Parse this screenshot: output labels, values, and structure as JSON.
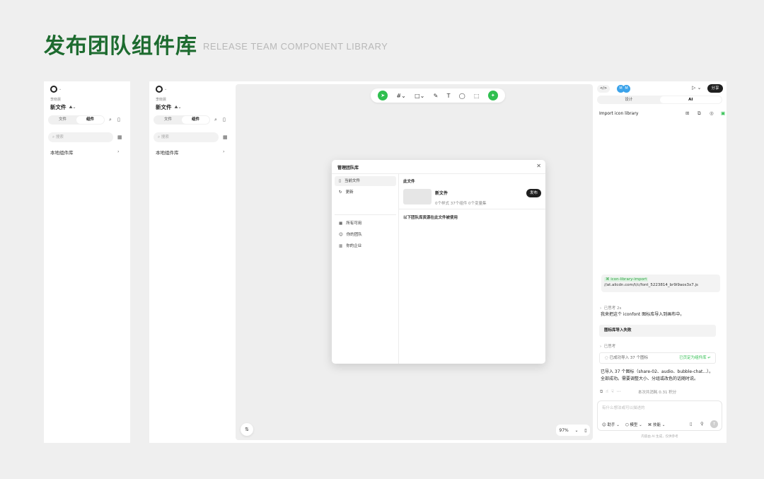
{
  "header": {
    "title": "发布团队组件库",
    "subtitle": "RELEASE TEAM COMPONENT LIBRARY"
  },
  "left_panel": {
    "team": "李晓晨",
    "file_name": "新文件",
    "tabs": [
      "文件",
      "组件"
    ],
    "search_placeholder": "搜索",
    "local_library": "本地组件库"
  },
  "toolbar": {
    "icons": [
      "move-tool",
      "frame-tool",
      "shape-tool",
      "pen-tool",
      "text-tool",
      "comment-tool",
      "crop-tool",
      "ai-tool"
    ]
  },
  "canvas": {
    "zoom": "97%"
  },
  "modal": {
    "title": "管理团队库",
    "sidebar": [
      {
        "label": "当前文件",
        "icon": "book-icon",
        "selected": true
      },
      {
        "label": "更新",
        "icon": "refresh-icon",
        "selected": false
      },
      {
        "label": "所有可用",
        "icon": "grid-icon",
        "selected": false
      },
      {
        "label": "你的团队",
        "icon": "team-icon",
        "selected": false
      },
      {
        "label": "你的企业",
        "icon": "building-icon",
        "selected": false
      }
    ],
    "section_title": "此文件",
    "library_name": "新文件",
    "library_stats": "0个样式   37个组件   0个变量集",
    "publish": "发布",
    "note": "以下团队库资源在此文件被使用"
  },
  "right_panel": {
    "avatars": [
      "M",
      "M"
    ],
    "share": "分享",
    "tabs": [
      "设计",
      "AI"
    ],
    "heading": "Import icon library",
    "tag": "icon-library-import",
    "url": "//at.alicdn.com/t/c/font_5223814_br9i9aos3x7.js",
    "thought_1": "已思考 2s",
    "message_1": "我来把这个 iconfont 图标库导入到画布中。",
    "fail_bar": "图标库导入失败",
    "thought_2": "已思考",
    "success_card": "已成功导入 37 个图标",
    "success_card_right": "已页定为组件库 ↵",
    "result_line_1": "已导入 37 个图标（share-02、audio、bubble-chat...）。",
    "result_line_2": "全部成功。需要调整大小、分组或改色的话随时说。",
    "cost": "本次共消耗 0.31 积分",
    "input_placeholder": "有什么想法或可以描述的",
    "input_tools": [
      "助手",
      "模型",
      "技能"
    ],
    "footnote": "内容由 AI 生成，仅供参考"
  }
}
